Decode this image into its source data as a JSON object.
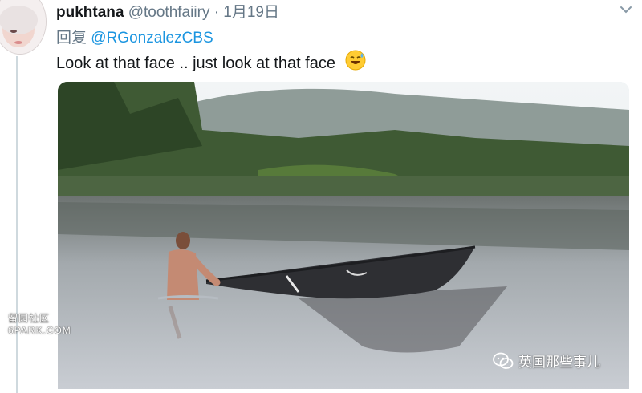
{
  "tweet": {
    "display_name": "pukhtana",
    "handle": "@toothfaiiry",
    "separator": "·",
    "date": "1月19日",
    "reply_prefix": "回复",
    "reply_to": "@RGonzalezCBS",
    "text": "Look at that face .. just look at that face",
    "emoji": "sweat-smile-emoji",
    "menu_icon": "chevron-down-icon"
  },
  "watermarks": {
    "left_line1": "留园社区",
    "left_line2": "6PARK.COM",
    "right_text": "英国那些事儿",
    "right_icon": "wechat-icon"
  },
  "colors": {
    "link": "#1b95e0",
    "secondary_text": "#657786",
    "primary_text": "#14171a"
  }
}
